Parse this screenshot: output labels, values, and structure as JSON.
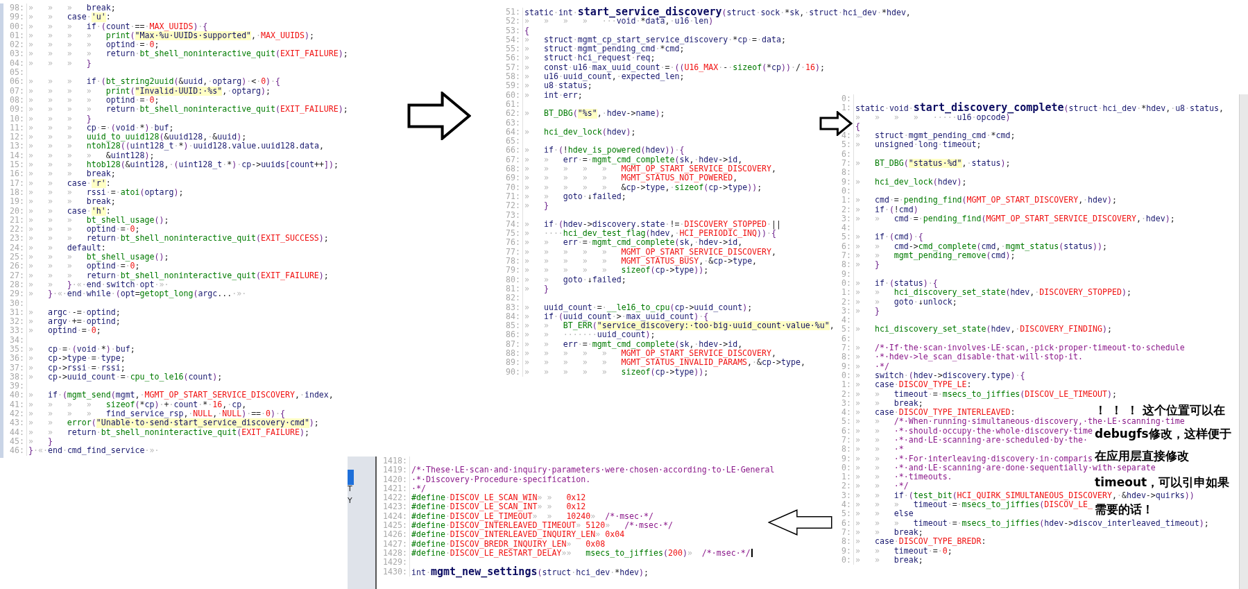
{
  "panels": [
    {
      "lines": [
        {
          "num": "98:",
          "text": "»\t»\t»\tbreak;"
        },
        {
          "num": "99:",
          "text": "»\t»\tcase·'u':"
        },
        {
          "num": "00:",
          "text": "»\t»\t»\tif·(count·==·MAX_UUIDS)·{"
        },
        {
          "num": "01:",
          "text": "»\t»\t»\t»\tprint(\"Max·%u·UUIDs·supported\",·MAX_UUIDS);"
        },
        {
          "num": "02:",
          "text": "»\t»\t»\t»\toptind·=·0;"
        },
        {
          "num": "03:",
          "text": "»\t»\t»\t»\treturn·bt_shell_noninteractive_quit(EXIT_FAILURE);"
        },
        {
          "num": "04:",
          "text": "»\t»\t»\t}"
        },
        {
          "num": "05:"
        },
        {
          "num": "06:",
          "text": "»\t»\t»\tif·(bt_string2uuid(&uuid,·optarg)·<·0)·{"
        },
        {
          "num": "07:",
          "text": "»\t»\t»\t»\tprint(\"Invalid·UUID:·%s\",·optarg);"
        },
        {
          "num": "08:",
          "text": "»\t»\t»\t»\toptind·=·0;"
        },
        {
          "num": "09:",
          "text": "»\t»\t»\t»\treturn·bt_shell_noninteractive_quit(EXIT_FAILURE);"
        },
        {
          "num": "10:",
          "text": "»\t»\t»\t}"
        },
        {
          "num": "11:",
          "text": "»\t»\t»\tcp·=·(void·*)·buf;"
        },
        {
          "num": "12:",
          "text": "»\t»\t»\tuuid_to_uuid128(&uuid128,·&uuid);"
        },
        {
          "num": "13:",
          "text": "»\t»\t»\tntoh128((uint128_t·*)·uuid128.value.uuid128.data,"
        },
        {
          "num": "14:",
          "text": "»\t»\t»\t»\t&uint128);"
        },
        {
          "num": "15:",
          "text": "»\t»\t»\thtob128(&uint128,·(uint128_t·*)·cp->uuids[count++]);"
        },
        {
          "num": "16:",
          "text": "»\t»\t»\tbreak;"
        },
        {
          "num": "17:",
          "text": "»\t»\tcase·'r':"
        },
        {
          "num": "18:",
          "text": "»\t»\t»\trssi·=·atoi(optarg);"
        },
        {
          "num": "19:",
          "text": "»\t»\t»\tbreak;"
        },
        {
          "num": "20:",
          "text": "»\t»\tcase·'h':"
        },
        {
          "num": "21:",
          "text": "»\t»\t»\tbt_shell_usage();"
        },
        {
          "num": "22:",
          "text": "»\t»\t»\toptind·=·0;"
        },
        {
          "num": "23:",
          "text": "»\t»\t»\treturn·bt_shell_noninteractive_quit(EXIT_SUCCESS);"
        },
        {
          "num": "24:",
          "text": "»\t»\tdefault:"
        },
        {
          "num": "25:",
          "text": "»\t»\t»\tbt_shell_usage();"
        },
        {
          "num": "26:",
          "text": "»\t»\t»\toptind·=·0;"
        },
        {
          "num": "27:",
          "text": "»\t»\t»\treturn·bt_shell_noninteractive_quit(EXIT_FAILURE);"
        },
        {
          "num": "28:",
          "text": "»\t»\t}·«·end·switch·opt·»·"
        },
        {
          "num": "29:",
          "text": "»\t}·«·end·while·(opt=getopt_long(argc...·»·"
        },
        {
          "num": "30:"
        },
        {
          "num": "31:",
          "text": "»\targc·-=·optind;"
        },
        {
          "num": "32:",
          "text": "»\targv·+=·optind;"
        },
        {
          "num": "33:",
          "text": "»\toptind·=·0;"
        },
        {
          "num": "34:"
        },
        {
          "num": "35:",
          "text": "»\tcp·=·(void·*)·buf;"
        },
        {
          "num": "36:",
          "text": "»\tcp->type·=·type;"
        },
        {
          "num": "37:",
          "text": "»\tcp->rssi·=·rssi;"
        },
        {
          "num": "38:",
          "text": "»\tcp->uuid_count·=·cpu_to_le16(count);"
        },
        {
          "num": "39:"
        },
        {
          "num": "40:",
          "text": "»\tif·(mgmt_send(mgmt,·MGMT_OP_START_SERVICE_DISCOVERY,·index,"
        },
        {
          "num": "41:",
          "text": "»\t»\t»\t»\tsizeof(*cp)·+·count·*·16,·cp,"
        },
        {
          "num": "42:",
          "text": "»\t»\t»\t»\tfind_service_rsp,·NULL,·NULL)·==·0)·{"
        },
        {
          "num": "43:",
          "text": "»\t»\terror(\"Unable·to·send·start_service_discovery·cmd\");"
        },
        {
          "num": "44:",
          "text": "»\t»\treturn·bt_shell_noninteractive_quit(EXIT_FAILURE);"
        },
        {
          "num": "45:",
          "text": "»\t}"
        },
        {
          "num": "46:",
          "text": "}·«·end·cmd_find_service·»·"
        }
      ]
    },
    {
      "lines": [
        {
          "num": "51:",
          "kind": "signature",
          "pre": "static·int·",
          "name": "start_service_discovery",
          "post": "(struct·sock·*sk,·struct·hci_dev·*hdev,"
        },
        {
          "num": "52:",
          "text": "»\t»\t»\t»\t···void·*data,·u16·len)"
        },
        {
          "num": "53:",
          "text": "{"
        },
        {
          "num": "54:",
          "text": "»\tstruct·mgmt_cp_start_service_discovery·*cp·=·data;"
        },
        {
          "num": "55:",
          "text": "»\tstruct·mgmt_pending_cmd·*cmd;"
        },
        {
          "num": "56:",
          "text": "»\tstruct·hci_request·req;"
        },
        {
          "num": "57:",
          "text": "»\tconst·u16·max_uuid_count·=·((U16_MAX·-·sizeof(*cp))·/·16);"
        },
        {
          "num": "58:",
          "text": "»\tu16·uuid_count,·expected_len;"
        },
        {
          "num": "59:",
          "text": "»\tu8·status;"
        },
        {
          "num": "60:",
          "text": "»\tint·err;"
        },
        {
          "num": "61:"
        },
        {
          "num": "62:",
          "text": "»\tBT_DBG(\"%s\",·hdev->name);"
        },
        {
          "num": "63:"
        },
        {
          "num": "64:",
          "text": "»\thci_dev_lock(hdev);"
        },
        {
          "num": "65:"
        },
        {
          "num": "66:",
          "text": "»\tif·(!hdev_is_powered(hdev))·{"
        },
        {
          "num": "67:",
          "text": "»\t»\terr·=·mgmt_cmd_complete(sk,·hdev->id,"
        },
        {
          "num": "68:",
          "text": "»\t»\t»\t»\t»\tMGMT_OP_START_SERVICE_DISCOVERY,"
        },
        {
          "num": "69:",
          "text": "»\t»\t»\t»\t»\tMGMT_STATUS_NOT_POWERED,"
        },
        {
          "num": "70:",
          "text": "»\t»\t»\t»\t»\t&cp->type,·sizeof(cp->type));"
        },
        {
          "num": "71:",
          "text": "»\t»\tgoto·↓failed;"
        },
        {
          "num": "72:",
          "text": "»\t}"
        },
        {
          "num": "73:"
        },
        {
          "num": "74:",
          "text": "»\tif·(hdev->discovery.state·!=·DISCOVERY_STOPPED·||"
        },
        {
          "num": "75:",
          "text": "»\t····hci_dev_test_flag(hdev,·HCI_PERIODIC_INQ))·{"
        },
        {
          "num": "76:",
          "text": "»\t»\terr·=·mgmt_cmd_complete(sk,·hdev->id,"
        },
        {
          "num": "77:",
          "text": "»\t»\t»\t»\t»\tMGMT_OP_START_SERVICE_DISCOVERY,"
        },
        {
          "num": "78:",
          "text": "»\t»\t»\t»\t»\tMGMT_STATUS_BUSY,·&cp->type,"
        },
        {
          "num": "79:",
          "text": "»\t»\t»\t»\t»\tsizeof(cp->type));"
        },
        {
          "num": "80:",
          "text": "»\t»\tgoto·↓failed;"
        },
        {
          "num": "81:",
          "text": "»\t}"
        },
        {
          "num": "82:"
        },
        {
          "num": "83:",
          "text": "»\tuuid_count·=·__le16_to_cpu(cp->uuid_count);"
        },
        {
          "num": "84:",
          "text": "»\tif·(uuid_count·>·max_uuid_count)·{"
        },
        {
          "num": "85:",
          "text": "»\t»\tBT_ERR(\"service_discovery:·too·big·uuid_count·value·%u\","
        },
        {
          "num": "86:",
          "text": "»\t»\t·······uuid_count);"
        },
        {
          "num": "87:",
          "text": "»\t»\terr·=·mgmt_cmd_complete(sk,·hdev->id,"
        },
        {
          "num": "88:",
          "text": "»\t»\t»\t»\t»\tMGMT_OP_START_SERVICE_DISCOVERY,"
        },
        {
          "num": "89:",
          "text": "»\t»\t»\t»\t»\tMGMT_STATUS_INVALID_PARAMS,·&cp->type,"
        },
        {
          "num": "90:",
          "text": "»\t»\t»\t»\t»\tsizeof(cp->type));"
        }
      ]
    },
    {
      "lines": [
        {
          "num": "0:"
        },
        {
          "num": "1:",
          "kind": "signature",
          "pre": "static·void·",
          "name": "start_discovery_complete",
          "post": "(struct·hci_dev·*hdev,·u8·status,"
        },
        {
          "text": "»\t»\t»\t»\t·····u16·opcode)"
        },
        {
          "text": "{"
        },
        {
          "num": "4:",
          "text": "»\tstruct·mgmt_pending_cmd·*cmd;"
        },
        {
          "num": "5:",
          "text": "»\tunsigned·long·timeout;"
        },
        {
          "num": "6:"
        },
        {
          "num": "7:",
          "text": "»\tBT_DBG(\"status·%d\",·status);"
        },
        {
          "num": "8:"
        },
        {
          "num": "9:",
          "text": "»\thci_dev_lock(hdev);"
        },
        {
          "num": "0:"
        },
        {
          "num": "1:",
          "text": "»\tcmd·=·pending_find(MGMT_OP_START_DISCOVERY,·hdev);"
        },
        {
          "num": "2:",
          "text": "»\tif·(!cmd)"
        },
        {
          "num": "3:",
          "text": "»\t»\tcmd·=·pending_find(MGMT_OP_START_SERVICE_DISCOVERY,·hdev);"
        },
        {
          "num": "4:"
        },
        {
          "num": "5:",
          "text": "»\tif·(cmd)·{"
        },
        {
          "num": "6:",
          "text": "»\t»\tcmd->cmd_complete(cmd,·mgmt_status(status));"
        },
        {
          "num": "7:",
          "text": "»\t»\tmgmt_pending_remove(cmd);"
        },
        {
          "num": "8:",
          "text": "»\t}"
        },
        {
          "num": "9:"
        },
        {
          "num": "0:",
          "text": "»\tif·(status)·{"
        },
        {
          "num": "1:",
          "text": "»\t»\thci_discovery_set_state(hdev,·DISCOVERY_STOPPED);"
        },
        {
          "num": "2:",
          "text": "»\t»\tgoto·↓unlock;"
        },
        {
          "num": "3:",
          "text": "»\t}"
        },
        {
          "num": "4:"
        },
        {
          "num": "5:",
          "text": "»\thci_discovery_set_state(hdev,·DISCOVERY_FINDING);"
        },
        {
          "num": "6:"
        },
        {
          "num": "7:",
          "text": "»\t/*·If·the·scan·involves·LE·scan,·pick·proper·timeout·to·schedule"
        },
        {
          "num": "8:",
          "text": "»\t·*·hdev->le_scan_disable·that·will·stop·it."
        },
        {
          "num": "9:",
          "text": "»\t·*/"
        },
        {
          "num": "0:",
          "text": "»\tswitch·(hdev->discovery.type)·{"
        },
        {
          "num": "1:",
          "text": "»\tcase·DISCOV_TYPE_LE:"
        },
        {
          "num": "2:",
          "text": "»\t»\ttimeout·=·msecs_to_jiffies(DISCOV_LE_TIMEOUT);"
        },
        {
          "num": "3:",
          "text": "»\t»\tbreak;"
        },
        {
          "num": "4:",
          "text": "»\tcase·DISCOV_TYPE_INTERLEAVED:"
        },
        {
          "num": "5:",
          "text": "»\t»\t/*·When·running·simultaneous·discovery,·the·LE·scanning·time"
        },
        {
          "num": "6:",
          "text": "»\t»\t·*·should·occupy·the·whole·discovery·time"
        },
        {
          "num": "7:",
          "text": "»\t»\t·*·and·LE·scanning·are·scheduled·by·the·"
        },
        {
          "num": "8:",
          "text": "»\t»\t·*"
        },
        {
          "num": "9:",
          "text": "»\t»\t·*·For·interleaving·discovery·in·comparis"
        },
        {
          "num": "0:",
          "text": "»\t»\t·*·and·LE·scanning·are·done·sequentially·with·separate"
        },
        {
          "num": "1:",
          "text": "»\t»\t·*·timeouts."
        },
        {
          "num": "2:",
          "text": "»\t»\t·*/"
        },
        {
          "num": "3:",
          "text": "»\t»\tif·(test_bit(HCI_QUIRK_SIMULTANEOUS_DISCOVERY,·&hdev->quirks))"
        },
        {
          "num": "4:",
          "text": "»\t»\t»\ttimeout·=·msecs_to_jiffies(DISCOV_LE_"
        },
        {
          "num": "5:",
          "text": "»\t»\telse"
        },
        {
          "num": "6:",
          "text": "»\t»\t»\ttimeout·=·msecs_to_jiffies(hdev->discov_interleaved_timeout);"
        },
        {
          "num": "7:",
          "text": "»\t»\tbreak;"
        },
        {
          "num": "8:",
          "text": "»\tcase·DISCOV_TYPE_BREDR:"
        },
        {
          "num": "9:",
          "text": "»\t»\ttimeout·=·0;"
        },
        {
          "num": "0:",
          "text": "»\t»\tbreak;"
        }
      ]
    },
    {
      "lines": [
        {
          "num": "1418:"
        },
        {
          "num": "1419:",
          "text": "/*·These·LE·scan·and·inquiry·parameters·were·chosen·according·to·LE·General"
        },
        {
          "num": "1420:",
          "text": "·*·Discovery·Procedure·specification."
        },
        {
          "num": "1421:",
          "text": "·*/"
        },
        {
          "num": "1422:",
          "text": "#define·DISCOV_LE_SCAN_WIN»\t»\t0x12"
        },
        {
          "num": "1423:",
          "text": "#define·DISCOV_LE_SCAN_INT»\t»\t0x12"
        },
        {
          "num": "1424:",
          "text": "#define·DISCOV_LE_TIMEOUT»\t»\t10240»\t/*·msec·*/"
        },
        {
          "num": "1425:",
          "text": "#define·DISCOV_INTERLEAVED_TIMEOUT»\t5120»\t/*·msec·*/"
        },
        {
          "num": "1426:",
          "text": "#define·DISCOV_INTERLEAVED_INQUIRY_LEN»\t0x04"
        },
        {
          "num": "1427:",
          "text": "#define·DISCOV_BREDR_INQUIRY_LEN»\t0x08"
        },
        {
          "num": "1428:",
          "text": "#define·DISCOV_LE_RESTART_DELAY»»\tmsecs_to_jiffies(200)»\t/*·msec·*/"
        },
        {
          "num": "1429:"
        },
        {
          "num": "1430:",
          "kind": "signature",
          "pre": "int·",
          "name": "mgmt_new_settings",
          "post": "(struct·hci_dev·*hdev);"
        }
      ]
    }
  ],
  "background_window": {
    "texts": [
      "T",
      "Y"
    ]
  },
  "annotation": {
    "lines": [
      "！ ！ ！ 这个位置可以在",
      "debugfs修改，这样便于",
      "在应用层直接修改",
      "timeout，可以引申如果",
      "需要的话！"
    ]
  }
}
